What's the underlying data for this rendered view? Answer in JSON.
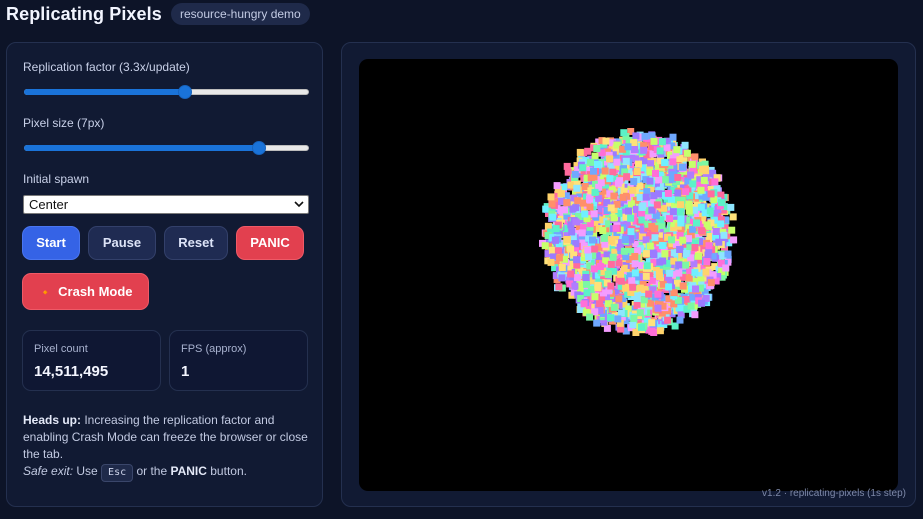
{
  "app": {
    "title": "Replicating Pixels",
    "tag": "resource-hungry demo"
  },
  "controls": {
    "replication_label": "Replication factor (3.3x/update)",
    "replication_fraction": 0.57,
    "pixel_size_label": "Pixel size (7px)",
    "pixel_size_fraction": 0.84,
    "spawn_label": "Initial spawn",
    "spawn_value": "Center",
    "buttons": {
      "start": "Start",
      "pause": "Pause",
      "reset": "Reset",
      "panic": "PANIC"
    },
    "crash_label": "Crash Mode",
    "crash_icon": "🔸"
  },
  "stats": {
    "pixel_count_label": "Pixel count",
    "pixel_count": "14,511,495",
    "fps_label": "FPS (approx)",
    "fps": "1"
  },
  "note": {
    "heads_up": "Heads up:",
    "warning": " Increasing the replication factor and enabling Crash Mode can freeze the browser or close the tab.",
    "safe_exit": "Safe exit:",
    "use": " Use ",
    "key": "Esc",
    "or_the": " or the ",
    "panic_word": "PANIC",
    "button_word": " button."
  },
  "footer": "v1.2 · replicating-pixels (1s step)",
  "colors": {
    "accent": "#3563e6",
    "danger": "#e2404f",
    "background": "#0d1428",
    "panel": "#111a33"
  }
}
